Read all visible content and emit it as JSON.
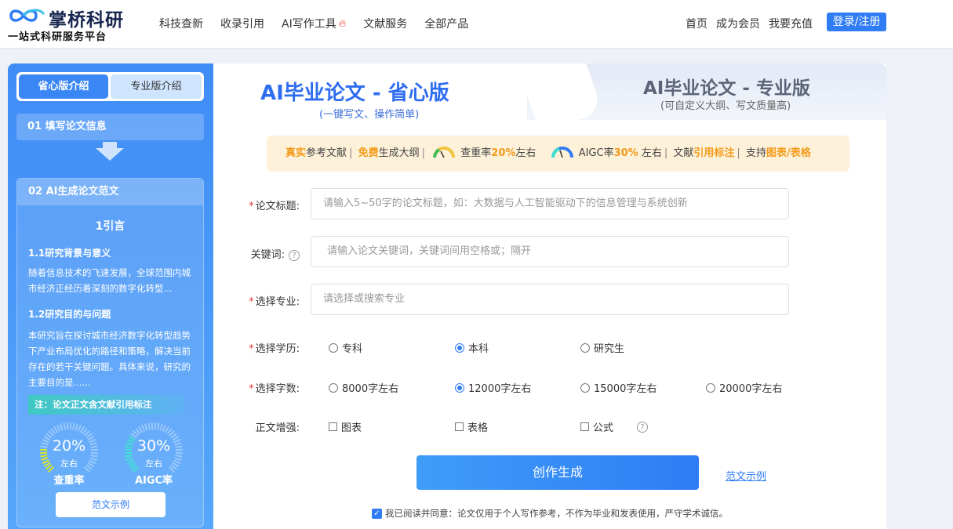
{
  "brand": {
    "name": "掌桥科研",
    "slogan": "一站式科研服务平台"
  },
  "nav": {
    "items": [
      "科技查新",
      "收录引用",
      "AI写作工具",
      "文献服务",
      "全部产品"
    ]
  },
  "right_nav": {
    "items": [
      "首页",
      "成为会员",
      "我要充值"
    ],
    "login": "登录/注册"
  },
  "left": {
    "tabs": [
      "省心版介绍",
      "专业版介绍"
    ],
    "step1": "01 填写论文信息",
    "step2": "02 AI生成论文范文",
    "doc": {
      "h1": "1引言",
      "sec1_title": "1.1研究背景与意义",
      "sec1_text": "随着信息技术的飞速发展，全球范围内城市经济正经历着深刻的数字化转型...",
      "sec2_title": "1.2研究目的与问题",
      "sec2_text": "本研究旨在探讨城市经济数字化转型趋势下产业布局优化的路径和策略，解决当前存在的若干关键问题。具体来说，研究的主要目的是......"
    },
    "note": "注：论文正文含文献引用标注",
    "gauges": [
      {
        "value": "20%",
        "sub": "左右",
        "label": "查重率",
        "fraction": 0.2,
        "color": "#d8e62a"
      },
      {
        "value": "30%",
        "sub": "左右",
        "label": "AIGC率",
        "fraction": 0.3,
        "color": "#3fe2cf"
      }
    ],
    "sample_button": "范文示例"
  },
  "modes": {
    "basic": {
      "title": "AI毕业论文 - 省心版",
      "sub": "(一键写文、操作简单)"
    },
    "pro": {
      "title": "AI毕业论文 - 专业版",
      "sub": "(可自定义大纲、写文质量高)"
    }
  },
  "features": {
    "f1a": "真实",
    "f1b": "参考文献",
    "f2a": "免费",
    "f2b": "生成大纲",
    "f3a": "查重率",
    "f3b": "20%",
    "f3c": "左右",
    "f4a": "AIGC率",
    "f4b": "30%",
    "f4c": " 左右",
    "f5a": "文献",
    "f5b": "引用标注",
    "f6a": "支持",
    "f6b": "图表/表格"
  },
  "form": {
    "title_label": "论文标题:",
    "title_placeholder": "请输入5~50字的论文标题，如：大数据与人工智能驱动下的信息管理与系统创新",
    "keywords_label": "关键词:",
    "keywords_placeholder": "请输入论文关键词，关键词间用空格或；隔开",
    "major_label": "选择专业:",
    "major_placeholder": "请选择或搜索专业",
    "degree_label": "选择学历:",
    "degree_options": [
      "专科",
      "本科",
      "研究生"
    ],
    "degree_selected": "本科",
    "words_label": "选择字数:",
    "words_options": [
      "8000字左右",
      "12000字左右",
      "15000字左右",
      "20000字左右"
    ],
    "words_selected": "12000字左右",
    "enhance_label": "正文增强:",
    "enhance_options": [
      "图表",
      "表格",
      "公式"
    ],
    "create_button": "创作生成",
    "example_link": "范文示例",
    "agree_text": "我已阅读并同意：论文仅用于个人写作参考，不作为毕业和发表使用，严守学术诚信。"
  }
}
